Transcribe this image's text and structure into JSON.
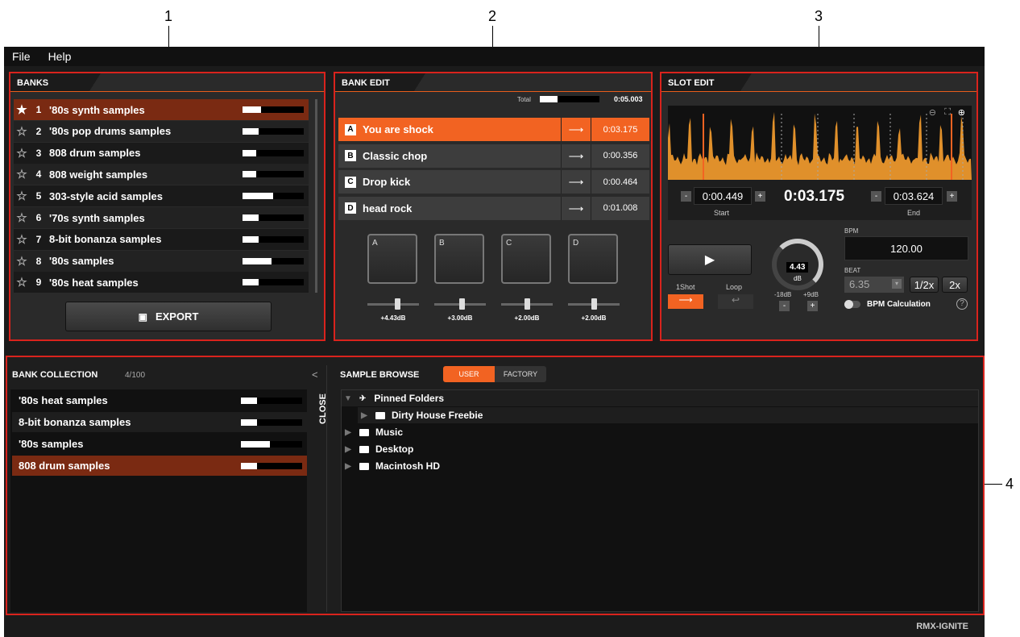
{
  "callouts": [
    "1",
    "2",
    "3",
    "4"
  ],
  "menu": [
    "File",
    "Help"
  ],
  "banks": {
    "title": "BANKS",
    "export_label": "EXPORT",
    "rows": [
      {
        "idx": "1",
        "label": "'80s synth samples",
        "fill": 0.3,
        "starred": true,
        "selected": true
      },
      {
        "idx": "2",
        "label": "'80s pop drums samples",
        "fill": 0.26,
        "starred": false
      },
      {
        "idx": "3",
        "label": "808 drum samples",
        "fill": 0.22,
        "starred": false
      },
      {
        "idx": "4",
        "label": "808 weight samples",
        "fill": 0.22,
        "starred": false
      },
      {
        "idx": "5",
        "label": "303-style acid samples",
        "fill": 0.5,
        "starred": false
      },
      {
        "idx": "6",
        "label": "'70s synth samples",
        "fill": 0.26,
        "starred": false
      },
      {
        "idx": "7",
        "label": "8-bit bonanza samples",
        "fill": 0.26,
        "starred": false
      },
      {
        "idx": "8",
        "label": "'80s samples",
        "fill": 0.48,
        "starred": false
      },
      {
        "idx": "9",
        "label": "'80s heat samples",
        "fill": 0.26,
        "starred": false
      }
    ]
  },
  "bank_edit": {
    "title": "BANK EDIT",
    "total_label": "Total",
    "total_time": "0:05.003",
    "total_fill": 0.3,
    "slots": [
      {
        "letter": "A",
        "name": "You are shock",
        "arrow": "⟶",
        "time": "0:03.175",
        "active": true
      },
      {
        "letter": "B",
        "name": "Classic chop",
        "arrow": "⟶",
        "time": "0:00.356"
      },
      {
        "letter": "C",
        "name": "Drop kick",
        "arrow": "⟶",
        "time": "0:00.464"
      },
      {
        "letter": "D",
        "name": "head rock",
        "arrow": "⟶",
        "time": "0:01.008"
      }
    ],
    "pads": [
      "A",
      "B",
      "C",
      "D"
    ],
    "faders": [
      {
        "val": "+4.43dB",
        "pos": 0.6
      },
      {
        "val": "+3.00dB",
        "pos": 0.55
      },
      {
        "val": "+2.00dB",
        "pos": 0.5
      },
      {
        "val": "+2.00dB",
        "pos": 0.5
      }
    ]
  },
  "slot_edit": {
    "title": "SLOT EDIT",
    "start": "0:00.449",
    "start_label": "Start",
    "current": "0:03.175",
    "end": "0:03.624",
    "end_label": "End",
    "minus": "-",
    "plus": "+",
    "bpm_label": "BPM",
    "bpm_value": "120.00",
    "beat_label": "BEAT",
    "beat_value": "6.35",
    "half": "1/2x",
    "double": "2x",
    "oneshot": "1Shot",
    "loop": "Loop",
    "gain_value": "4.43",
    "gain_unit": "dB",
    "gain_min": "-18dB",
    "gain_max": "+9dB",
    "bpm_calc": "BPM Calculation",
    "help": "?"
  },
  "collection": {
    "title": "BANK COLLECTION",
    "count": "4/100",
    "close_label": "CLOSE",
    "collapse": "<",
    "rows": [
      {
        "label": "'80s heat samples",
        "fill": 0.26
      },
      {
        "label": "8-bit bonanza samples",
        "fill": 0.26
      },
      {
        "label": "'80s samples",
        "fill": 0.48
      },
      {
        "label": "808 drum samples",
        "fill": 0.26,
        "selected": true
      }
    ]
  },
  "browse": {
    "title": "SAMPLE BROWSE",
    "user": "USER",
    "factory": "FACTORY",
    "items": [
      {
        "label": "Pinned Folders",
        "level": 0,
        "open": true,
        "icon": "pin-icon"
      },
      {
        "label": "Dirty House Freebie",
        "level": 1,
        "icon": "folder-icon"
      },
      {
        "label": "Music",
        "level": 0,
        "icon": "folder-icon"
      },
      {
        "label": "Desktop",
        "level": 0,
        "icon": "folder-icon"
      },
      {
        "label": "Macintosh HD",
        "level": 0,
        "icon": "folder-icon"
      }
    ]
  },
  "footer": {
    "brand": "RMX-IGNITE"
  },
  "colors": {
    "accent": "#f26322",
    "selected_row": "#7a2a12",
    "highlight": "#d9231d"
  }
}
